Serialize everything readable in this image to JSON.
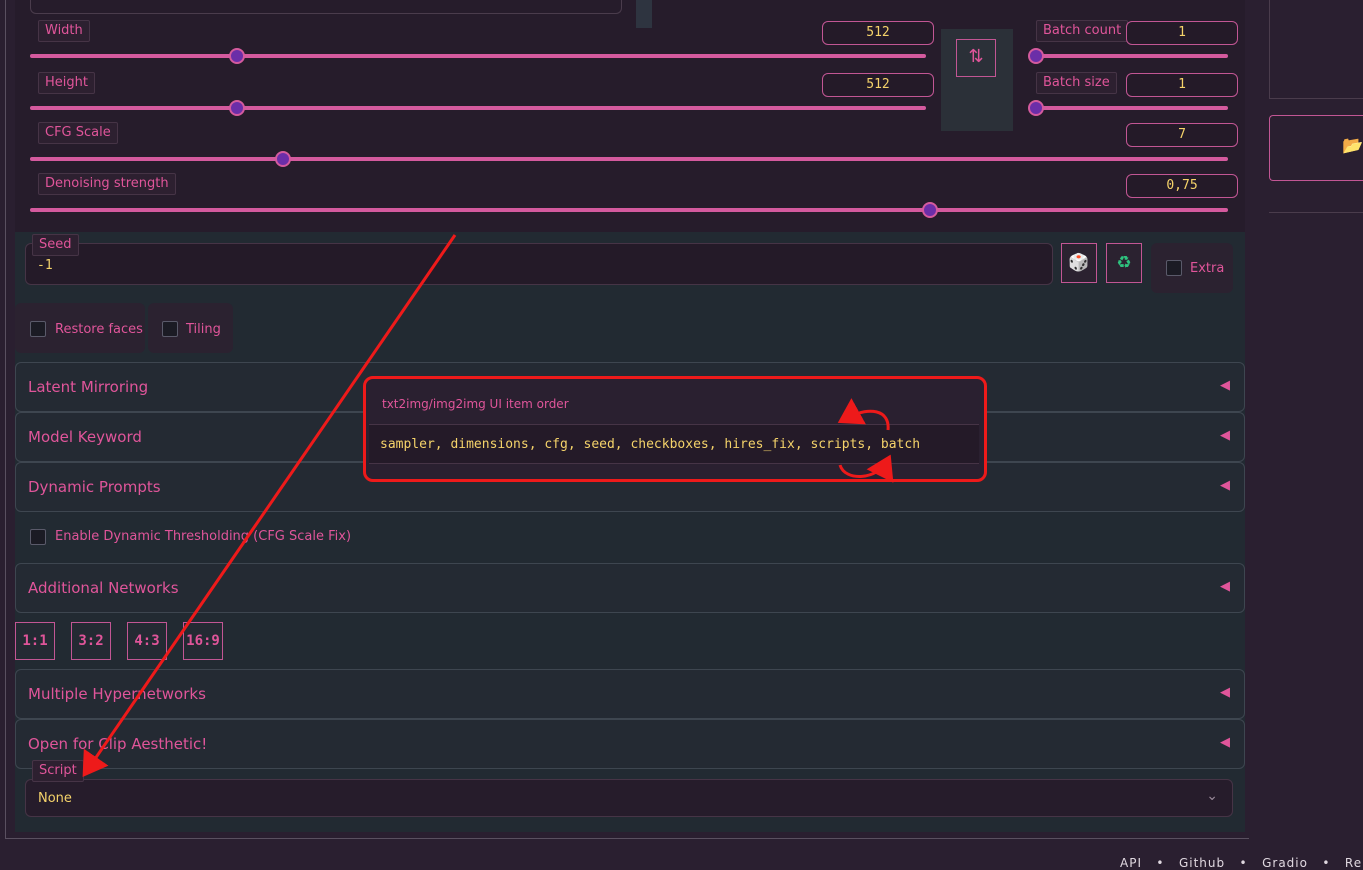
{
  "sliders": {
    "width": {
      "label": "Width",
      "value": "512",
      "fraction": 0.23
    },
    "height": {
      "label": "Height",
      "value": "512",
      "fraction": 0.23
    },
    "batch_count": {
      "label": "Batch count",
      "value": "1",
      "fraction": 0.0
    },
    "batch_size": {
      "label": "Batch size",
      "value": "1",
      "fraction": 0.0
    },
    "cfg_scale": {
      "label": "CFG Scale",
      "value": "7",
      "fraction": 0.21
    },
    "denoising": {
      "label": "Denoising strength",
      "value": "0,75",
      "fraction": 0.75
    }
  },
  "swap_icon": "swap-arrows-icon",
  "seed": {
    "label": "Seed",
    "value": "-1",
    "dice_icon": "dice-icon",
    "recycle_icon": "recycle-icon"
  },
  "extra_label": "Extra",
  "checkboxes": {
    "restore_faces": "Restore faces",
    "tiling": "Tiling"
  },
  "accordions": {
    "latent_mirroring": "Latent Mirroring",
    "model_keyword": "Model Keyword",
    "dynamic_prompts": "Dynamic Prompts",
    "additional_networks": "Additional Networks",
    "multiple_hypernetworks": "Multiple Hypernetworks",
    "clip_aesthetic": "Open for Clip Aesthetic!"
  },
  "dynamic_thresholding_label": "Enable Dynamic Thresholding (CFG Scale Fix)",
  "ratios": [
    "1:1",
    "3:2",
    "4:3",
    "16:9"
  ],
  "script": {
    "label": "Script",
    "value": "None"
  },
  "popup": {
    "title": "txt2img/img2img UI item order",
    "value": "sampler, dimensions, cfg, seed, checkboxes, hires_fix, scripts, batch"
  },
  "colors": {
    "accent": "#e0559a",
    "value_text": "#f5d36a",
    "annotation": "#ee1a1a"
  }
}
